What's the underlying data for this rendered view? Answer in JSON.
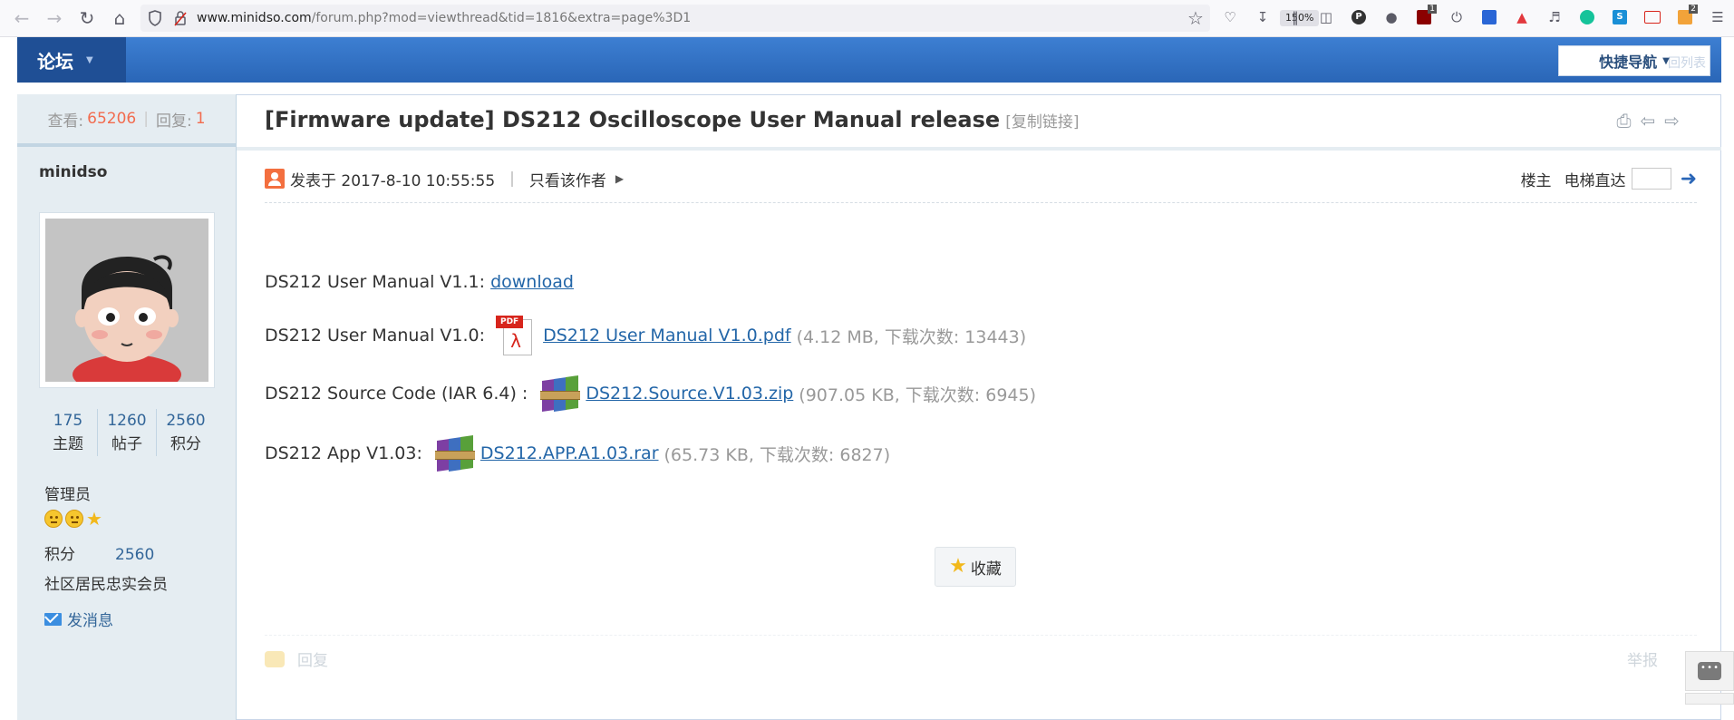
{
  "browser": {
    "url_host": "www.minidso.com",
    "url_path": "/forum.php?mod=viewthread&tid=1816&extra=page%3D1",
    "zoom": "150%",
    "ext_badge_1": "1",
    "ext_badge_2": "2"
  },
  "header": {
    "forum_tab": "论坛",
    "quick_nav": "快捷导航",
    "quick_nav_ghost": "回列表"
  },
  "sidebar": {
    "views_label": "查看:",
    "views_value": "65206",
    "replies_label": "回复:",
    "replies_value": "1",
    "author": "minidso",
    "stats": [
      {
        "value": "175",
        "label": "主题"
      },
      {
        "value": "1260",
        "label": "帖子"
      },
      {
        "value": "2560",
        "label": "积分"
      }
    ],
    "role": "管理员",
    "points_label": "积分",
    "points_value": "2560",
    "member_title": "社区居民忠实会员",
    "send_message": "发消息"
  },
  "post": {
    "title": "[Firmware update] DS212 Oscilloscope User Manual release",
    "copy_link": "[复制链接]",
    "posted_at": "发表于 2017-8-10 10:55:55",
    "only_author": "只看该作者",
    "floor_label": "楼主",
    "elevator_label": "电梯直达",
    "lines": [
      {
        "prefix": "DS212 User Manual V1.1: ",
        "link": "download"
      },
      {
        "prefix": "DS212 User Manual V1.0: ",
        "link": "DS212 User Manual V1.0.pdf",
        "meta": "(4.12 MB, 下载次数: 13443)"
      },
      {
        "prefix": "DS212 Source Code (IAR 6.4) : ",
        "link": "DS212.Source.V1.03.zip",
        "meta": "(907.05 KB, 下载次数: 6945)"
      },
      {
        "prefix": "DS212 App V1.03: ",
        "link": "DS212.APP.A1.03.rar",
        "meta": "(65.73 KB, 下载次数: 6827)"
      }
    ],
    "favorite": "收藏",
    "reply": "回复",
    "report": "举报"
  },
  "icons": {
    "pdf_tag": "PDF"
  }
}
